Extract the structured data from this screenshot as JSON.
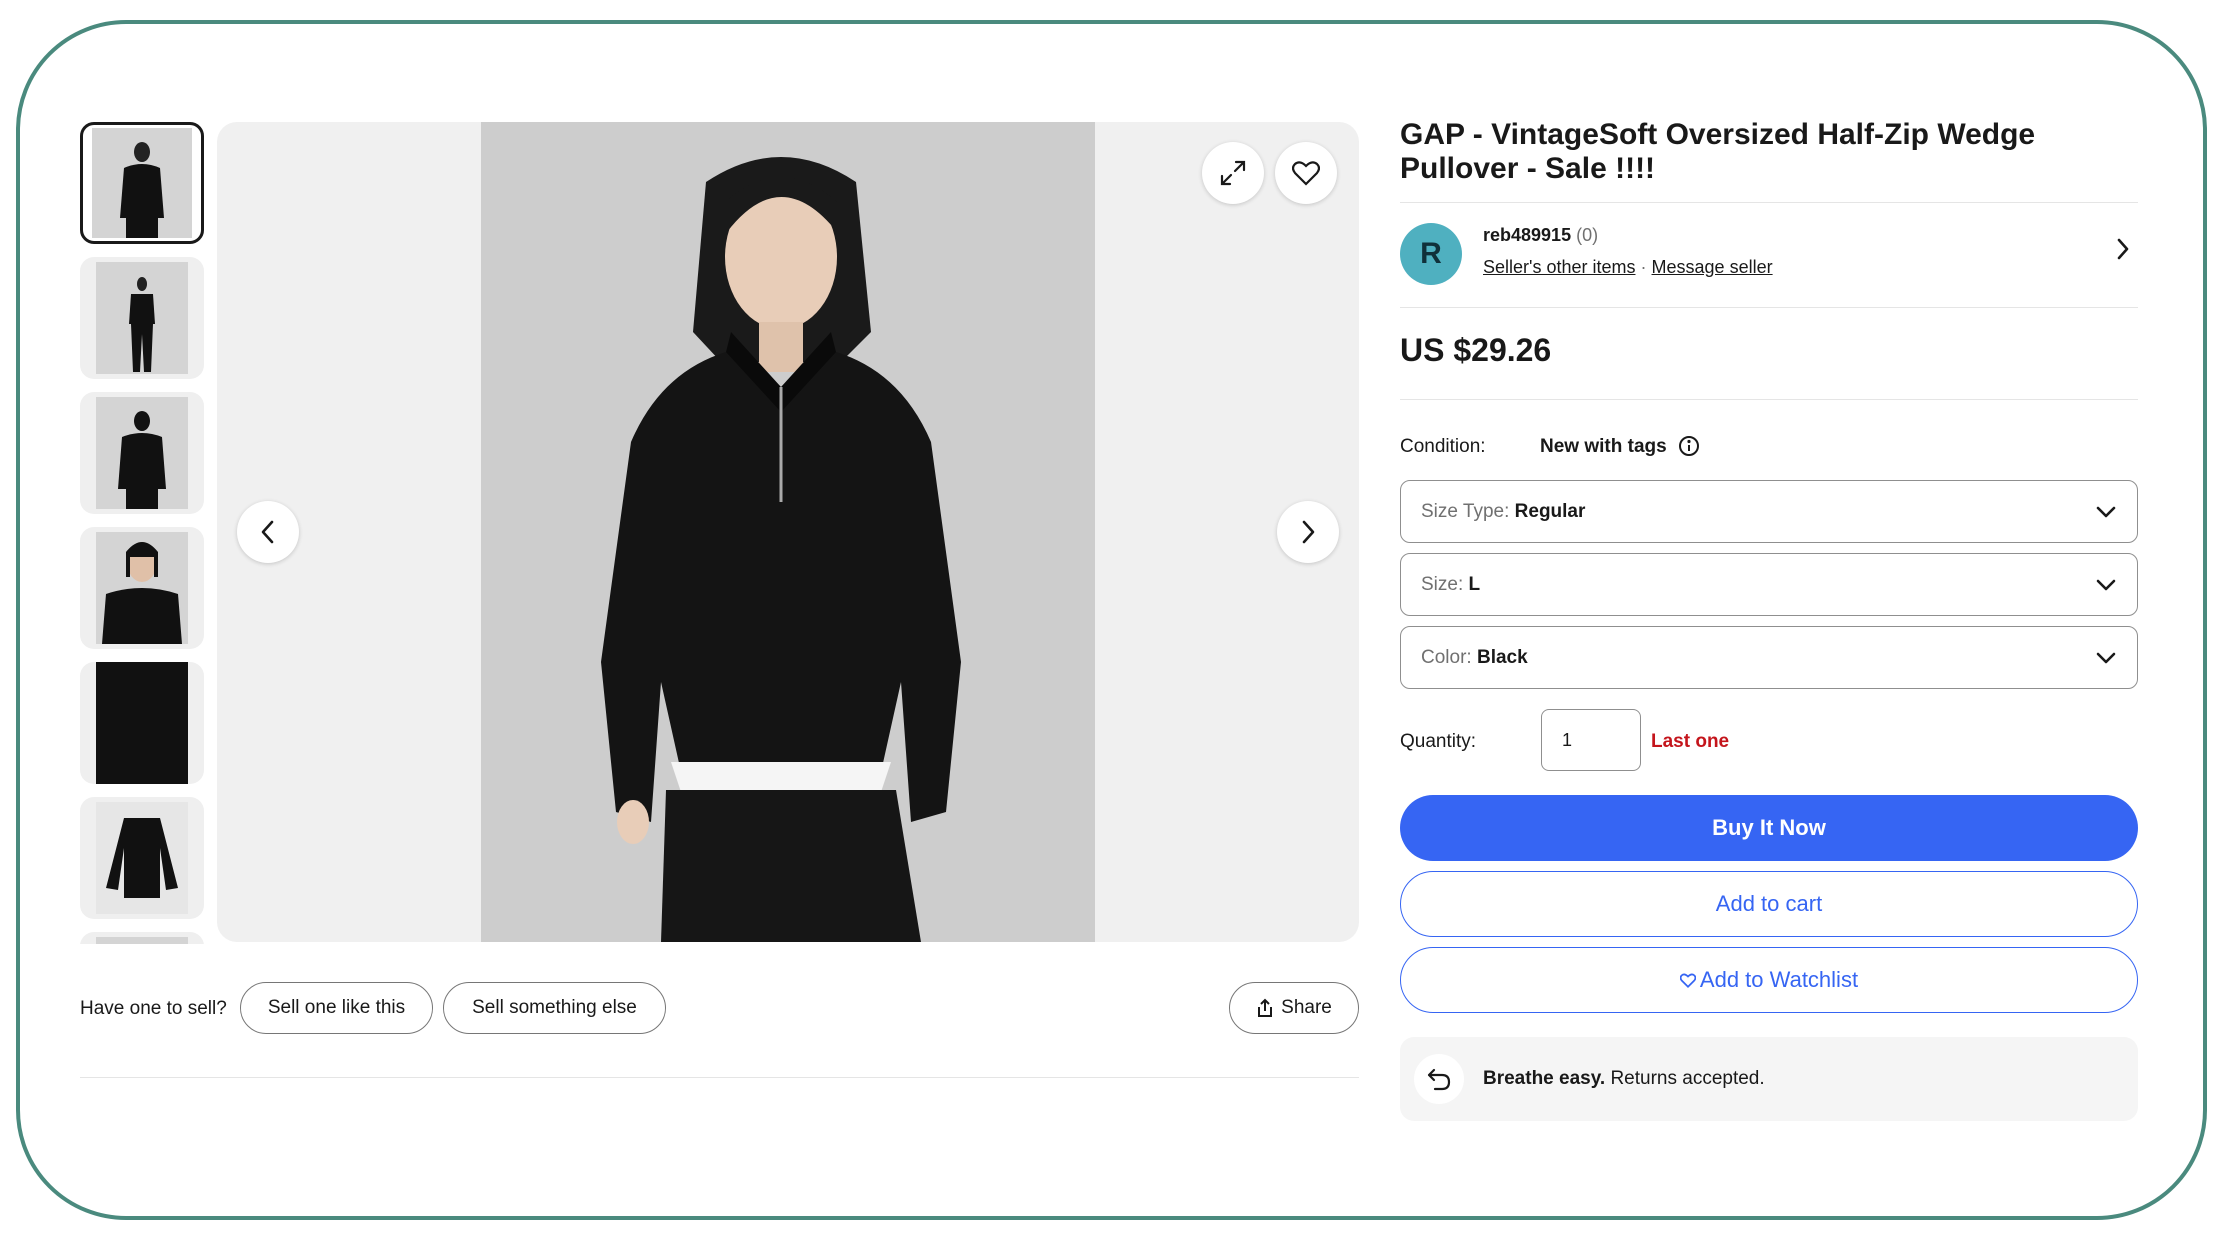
{
  "product": {
    "title": "GAP - VintageSoft Oversized Half-Zip Wedge Pullover - Sale !!!!",
    "price": "US $29.26",
    "thumbnails": [
      "front-view",
      "full-body-view",
      "back-view",
      "close-up-view",
      "fabric-detail",
      "flat-lay-view"
    ]
  },
  "seller": {
    "avatar_letter": "R",
    "name": "reb489915",
    "feedback": "(0)",
    "other_items": "Seller's other items",
    "separator": "·",
    "message": "Message seller"
  },
  "condition": {
    "label": "Condition:",
    "value": "New with tags"
  },
  "selects": {
    "size_type": {
      "label": "Size Type:",
      "value": "Regular"
    },
    "size": {
      "label": "Size:",
      "value": "L"
    },
    "color": {
      "label": "Color:",
      "value": "Black"
    }
  },
  "quantity": {
    "label": "Quantity:",
    "value": "1",
    "status": "Last one"
  },
  "actions": {
    "buy_now": "Buy It Now",
    "add_to_cart": "Add to cart",
    "add_to_watchlist": "Add to Watchlist"
  },
  "returns": {
    "bold": "Breathe easy.",
    "text": " Returns accepted."
  },
  "sell": {
    "prompt": "Have one to sell?",
    "sell_like": "Sell one like this",
    "sell_else": "Sell something else",
    "share": "Share"
  },
  "colors": {
    "primary": "#3665f3",
    "alert": "#c4151c",
    "frame": "#4a8a7e",
    "avatar": "#4fb0c0"
  }
}
